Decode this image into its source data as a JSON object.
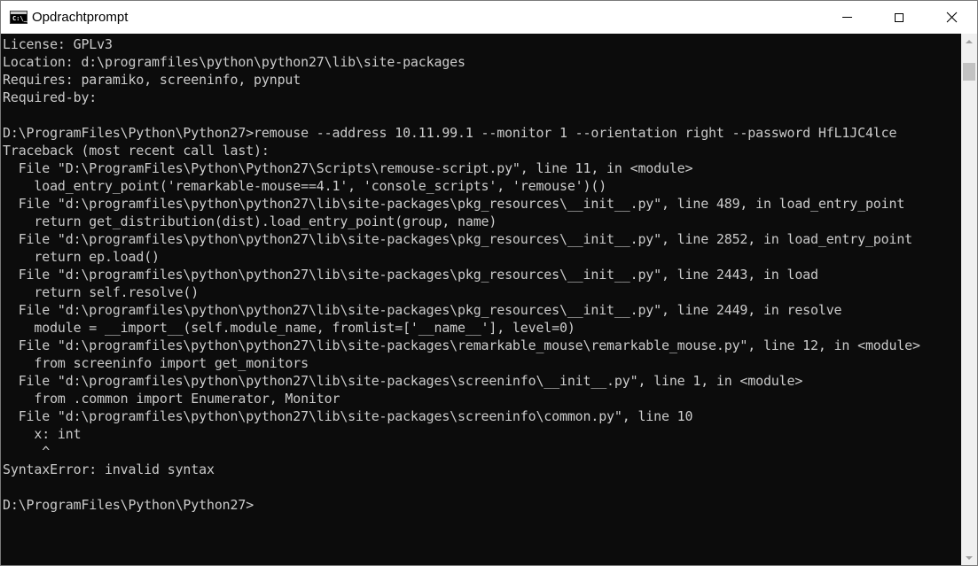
{
  "window": {
    "title": "Opdrachtprompt",
    "app_icon_text": "C:\\_",
    "icons": {
      "app": "command-prompt-icon",
      "minimize": "minimize-icon",
      "maximize": "maximize-icon",
      "close": "close-icon"
    },
    "close_glyph": "✕"
  },
  "colors": {
    "console_bg": "#0c0c0c",
    "console_text": "#cccccc",
    "titlebar_bg": "#ffffff",
    "scrollbar_bg": "#f0f0f0",
    "scrollbar_thumb": "#c2c2c2"
  },
  "console": {
    "lines": [
      "License: GPLv3",
      "Location: d:\\programfiles\\python\\python27\\lib\\site-packages",
      "Requires: paramiko, screeninfo, pynput",
      "Required-by:",
      "",
      "D:\\ProgramFiles\\Python\\Python27>remouse --address 10.11.99.1 --monitor 1 --orientation right --password HfL1JC4lce",
      "Traceback (most recent call last):",
      "  File \"D:\\ProgramFiles\\Python\\Python27\\Scripts\\remouse-script.py\", line 11, in <module>",
      "    load_entry_point('remarkable-mouse==4.1', 'console_scripts', 'remouse')()",
      "  File \"d:\\programfiles\\python\\python27\\lib\\site-packages\\pkg_resources\\__init__.py\", line 489, in load_entry_point",
      "    return get_distribution(dist).load_entry_point(group, name)",
      "  File \"d:\\programfiles\\python\\python27\\lib\\site-packages\\pkg_resources\\__init__.py\", line 2852, in load_entry_point",
      "    return ep.load()",
      "  File \"d:\\programfiles\\python\\python27\\lib\\site-packages\\pkg_resources\\__init__.py\", line 2443, in load",
      "    return self.resolve()",
      "  File \"d:\\programfiles\\python\\python27\\lib\\site-packages\\pkg_resources\\__init__.py\", line 2449, in resolve",
      "    module = __import__(self.module_name, fromlist=['__name__'], level=0)",
      "  File \"d:\\programfiles\\python\\python27\\lib\\site-packages\\remarkable_mouse\\remarkable_mouse.py\", line 12, in <module>",
      "    from screeninfo import get_monitors",
      "  File \"d:\\programfiles\\python\\python27\\lib\\site-packages\\screeninfo\\__init__.py\", line 1, in <module>",
      "    from .common import Enumerator, Monitor",
      "  File \"d:\\programfiles\\python\\python27\\lib\\site-packages\\screeninfo\\common.py\", line 10",
      "    x: int",
      "     ^",
      "SyntaxError: invalid syntax",
      "",
      "D:\\ProgramFiles\\Python\\Python27>"
    ]
  }
}
